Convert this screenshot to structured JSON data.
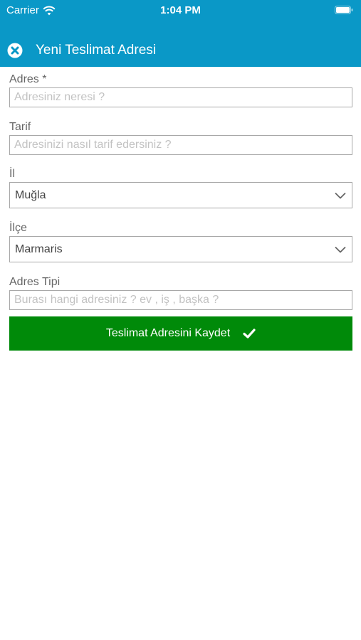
{
  "status_bar": {
    "carrier": "Carrier",
    "time": "1:04 PM"
  },
  "header": {
    "title": "Yeni Teslimat Adresi",
    "close_icon": "close-circle-icon",
    "background_color": "#0a98c7"
  },
  "form": {
    "address": {
      "label": "Adres *",
      "value": "",
      "placeholder": "Adresiniz neresi ?"
    },
    "directions": {
      "label": "Tarif",
      "value": "",
      "placeholder": "Adresinizi nasıl tarif edersiniz ?"
    },
    "province": {
      "label": "İl",
      "selected": "Muğla"
    },
    "district": {
      "label": "İlçe",
      "selected": "Marmaris"
    },
    "address_type": {
      "label": "Adres Tipi",
      "value": "",
      "placeholder": "Burası hangi adresiniz ? ev , iş , başka ?"
    }
  },
  "save_button": {
    "label": "Teslimat Adresini Kaydet",
    "icon": "check-icon",
    "color": "#008a09"
  }
}
